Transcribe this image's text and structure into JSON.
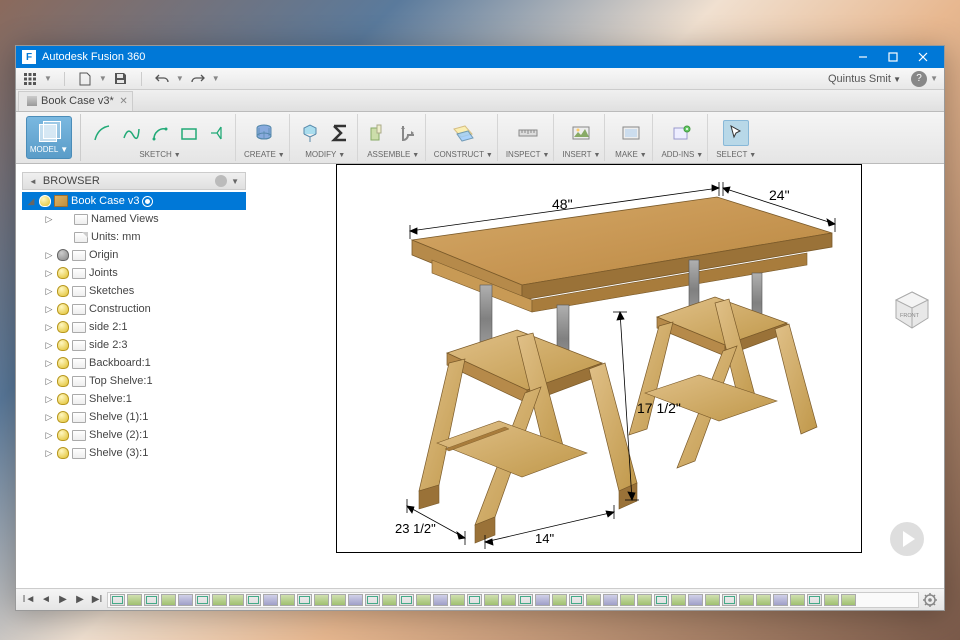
{
  "titlebar": {
    "app_name": "Autodesk Fusion 360",
    "icon_letter": "F"
  },
  "qat": {
    "user": "Quintus Smit"
  },
  "doc_tab": {
    "title": "Book Case v3*"
  },
  "ribbon": {
    "model": "MODEL",
    "groups": [
      {
        "id": "sketch",
        "label": "SKETCH"
      },
      {
        "id": "create",
        "label": "CREATE"
      },
      {
        "id": "modify",
        "label": "MODIFY"
      },
      {
        "id": "assemble",
        "label": "ASSEMBLE"
      },
      {
        "id": "construct",
        "label": "CONSTRUCT"
      },
      {
        "id": "inspect",
        "label": "INSPECT"
      },
      {
        "id": "insert",
        "label": "INSERT"
      },
      {
        "id": "make",
        "label": "MAKE"
      },
      {
        "id": "addins",
        "label": "ADD-INS"
      },
      {
        "id": "select",
        "label": "SELECT"
      }
    ]
  },
  "browser": {
    "title": "BROWSER",
    "root": "Book Case v3",
    "items": [
      {
        "label": "Named Views",
        "bulb": false,
        "icon": "folder"
      },
      {
        "label": "Units: mm",
        "bulb": false,
        "icon": "page",
        "noexpand": true
      },
      {
        "label": "Origin",
        "bulb": "off",
        "icon": "folder"
      },
      {
        "label": "Joints",
        "bulb": "on",
        "icon": "folder"
      },
      {
        "label": "Sketches",
        "bulb": "on",
        "icon": "folder"
      },
      {
        "label": "Construction",
        "bulb": "on",
        "icon": "folder"
      },
      {
        "label": "side 2:1",
        "bulb": "on",
        "icon": "comp"
      },
      {
        "label": "side 2:3",
        "bulb": "on",
        "icon": "comp"
      },
      {
        "label": "Backboard:1",
        "bulb": "on",
        "icon": "comp"
      },
      {
        "label": "Top Shelve:1",
        "bulb": "on",
        "icon": "comp2"
      },
      {
        "label": "Shelve:1",
        "bulb": "on",
        "icon": "comp"
      },
      {
        "label": "Shelve (1):1",
        "bulb": "on",
        "icon": "comp"
      },
      {
        "label": "Shelve (2):1",
        "bulb": "on",
        "icon": "comp"
      },
      {
        "label": "Shelve (3):1",
        "bulb": "on",
        "icon": "comp"
      }
    ]
  },
  "viewport": {
    "dims": {
      "width": "48\"",
      "depth": "24\"",
      "height": "17 1/2\"",
      "base_depth": "23 1/2\"",
      "base_width": "14\""
    }
  },
  "viewcube": {
    "face": "FRONT"
  },
  "timeline": {
    "step_count": 44
  }
}
